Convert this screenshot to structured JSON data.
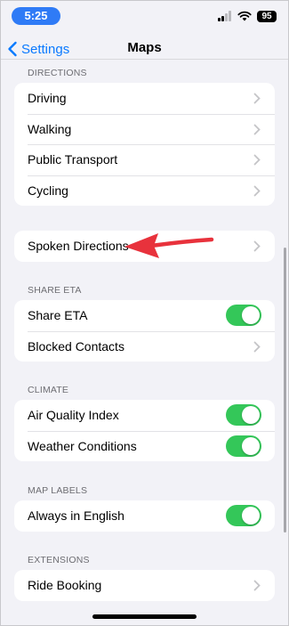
{
  "status_bar": {
    "time": "5:25",
    "battery": "95"
  },
  "nav": {
    "back_label": "Settings",
    "title": "Maps"
  },
  "sections": {
    "directions": {
      "header": "DIRECTIONS",
      "items": [
        "Driving",
        "Walking",
        "Public Transport",
        "Cycling"
      ]
    },
    "spoken": {
      "label": "Spoken Directions"
    },
    "share_eta": {
      "header": "SHARE ETA",
      "share_eta_label": "Share ETA",
      "share_eta_on": true,
      "blocked_label": "Blocked Contacts"
    },
    "climate": {
      "header": "CLIMATE",
      "air_quality_label": "Air Quality Index",
      "air_quality_on": true,
      "weather_label": "Weather Conditions",
      "weather_on": true
    },
    "map_labels": {
      "header": "MAP LABELS",
      "always_english_label": "Always in English",
      "always_english_on": true
    },
    "extensions": {
      "header": "EXTENSIONS",
      "ride_booking_label": "Ride Booking"
    }
  },
  "colors": {
    "accent": "#0a7aff",
    "toggle_on": "#34c759",
    "annotation_arrow": "#e8323c",
    "time_pill": "#2f7bf6"
  },
  "icons": [
    "wifi-icon",
    "cellular-signal-icon",
    "battery-icon",
    "chevron-left-icon",
    "chevron-right-icon",
    "red-arrow-icon"
  ]
}
